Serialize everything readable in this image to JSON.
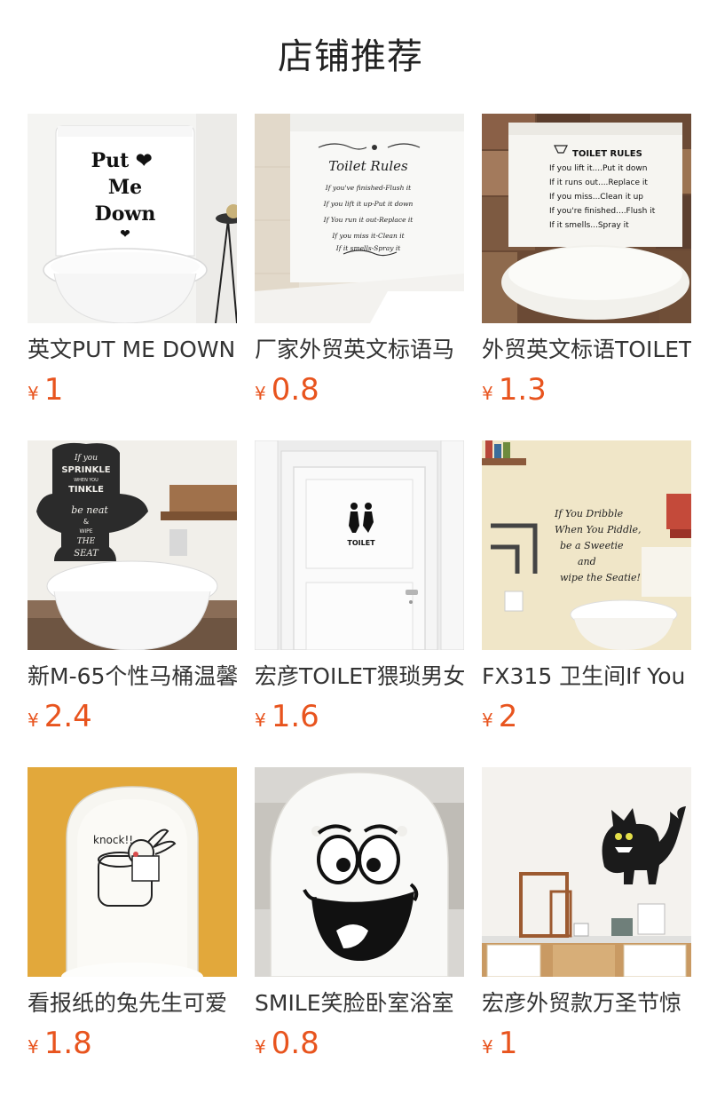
{
  "section": {
    "title": "店铺推荐"
  },
  "currency_symbol": "¥",
  "colors": {
    "price": "#e8541e",
    "text": "#333333"
  },
  "products": [
    {
      "name": "英文PUT ME DOWN",
      "price": "1",
      "image": {
        "icon": "toilet-sticker-put-me-down-image",
        "lines": [
          "Put ❤",
          "Me",
          "Down",
          "❤"
        ]
      }
    },
    {
      "name": "厂家外贸英文标语马",
      "price": "0.8",
      "image": {
        "icon": "toilet-rules-sticker-image",
        "lines": [
          "Toilet Rules",
          "If you've finished-Flush it",
          "If you lift it up-Put it down",
          "If You run it out-Replace it",
          "If you  miss it-Clean it",
          "If it smells-Spray it"
        ]
      }
    },
    {
      "name": "外贸英文标语TOILET",
      "price": "1.3",
      "image": {
        "icon": "toilet-rules-tank-sticker-image",
        "lines": [
          "TOILET RULES",
          "If you lift it....Put it down",
          "If it runs out....Replace it",
          "If you miss...Clean it up",
          "If you're finished....Flush it",
          "If it smells...Spray it"
        ]
      }
    },
    {
      "name": "新M-65个性马桶温馨",
      "price": "2.4",
      "image": {
        "icon": "sprinkle-wall-sticker-image",
        "lines": [
          "If you",
          "SPRINKLE",
          "WHEN YOU",
          "TINKLE",
          "be neat",
          "&",
          "WIPE",
          "THE",
          "SEAT"
        ]
      }
    },
    {
      "name": "宏彦TOILET猥琐男女",
      "price": "1.6",
      "image": {
        "icon": "toilet-door-sign-image",
        "lines": [
          "TOILET"
        ]
      }
    },
    {
      "name": "FX315 卫生间If You",
      "price": "2",
      "image": {
        "icon": "if-you-dribble-sticker-image",
        "lines": [
          "If You Dribble",
          "When You Piddle,",
          "be a Sweetie",
          "and",
          "wipe the Seatie!"
        ]
      }
    },
    {
      "name": "看报纸的兔先生可爱",
      "price": "1.8",
      "image": {
        "icon": "knock-rabbit-lid-sticker-image",
        "lines": [
          "knock!!"
        ]
      }
    },
    {
      "name": "SMILE笑脸卧室浴室",
      "price": "0.8",
      "image": {
        "icon": "smile-face-lid-sticker-image",
        "lines": []
      }
    },
    {
      "name": "宏彦外贸款万圣节惊",
      "price": "1",
      "image": {
        "icon": "black-cat-wall-sticker-image",
        "lines": []
      }
    }
  ]
}
